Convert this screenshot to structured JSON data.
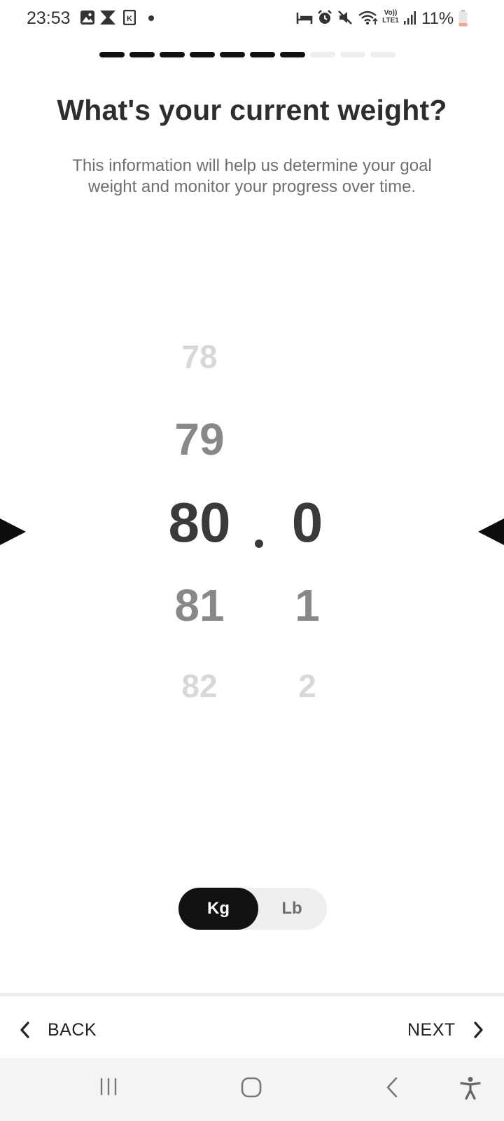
{
  "status_bar": {
    "time": "23:53",
    "battery": "11%",
    "left_icons": [
      "gallery-icon",
      "hourglass-icon",
      "k-app-icon",
      "notification-dot"
    ],
    "right_icons": [
      "sleep-mode-icon",
      "alarm-icon",
      "mute-icon",
      "wifi-icon",
      "volte-lte-icon",
      "signal-icon",
      "battery-icon"
    ],
    "network_label_top": "Vo))",
    "network_label_bottom": "LTE1"
  },
  "progress": {
    "total_steps": 10,
    "completed_steps": 7
  },
  "header": {
    "title": "What's your current weight?",
    "subtitle": "This information will help us determine your goal weight and monitor your progress over time."
  },
  "picker": {
    "integer_wheel": [
      "78",
      "79",
      "80",
      "81",
      "82"
    ],
    "decimal_wheel": [
      "",
      "",
      "0",
      "1",
      "2"
    ],
    "selected_integer": "80",
    "selected_decimal": "0"
  },
  "unit_toggle": {
    "kg_label": "Kg",
    "lb_label": "Lb",
    "selected": "Kg"
  },
  "bottom_nav": {
    "back_label": "BACK",
    "next_label": "NEXT"
  },
  "colors": {
    "accent": "#111111",
    "text": "#2e2e2e",
    "muted": "#6f6f6f",
    "faded_item": "#d8d8d8",
    "battery_low": "#f4a58a"
  }
}
